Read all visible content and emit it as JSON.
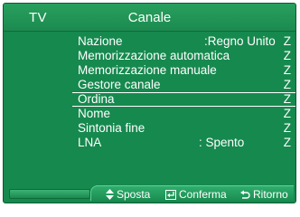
{
  "header": {
    "source": "TV",
    "title": "Canale"
  },
  "menu": [
    {
      "label": "Nazione",
      "value": ":Regno Unito",
      "arrow": "Z",
      "selected": false
    },
    {
      "label": "Memorizzazione automatica",
      "value": "",
      "arrow": "Z",
      "selected": false
    },
    {
      "label": "Memorizzazione manuale",
      "value": "",
      "arrow": "Z",
      "selected": false
    },
    {
      "label": "Gestore canale",
      "value": "",
      "arrow": "Z",
      "selected": false
    },
    {
      "label": "Ordina",
      "value": "",
      "arrow": "Z",
      "selected": true
    },
    {
      "label": "Nome",
      "value": "",
      "arrow": "Z",
      "selected": false
    },
    {
      "label": "Sintonia fine",
      "value": "",
      "arrow": "Z",
      "selected": false
    },
    {
      "label": "LNA",
      "value": ": Spento",
      "arrow": "Z",
      "selected": false
    }
  ],
  "footer": {
    "move": {
      "icon": "up-down-arrows-icon",
      "label": "Sposta"
    },
    "confirm": {
      "icon": "enter-icon",
      "label": "Conferma"
    },
    "back": {
      "icon": "return-icon",
      "label": "Ritorno"
    }
  },
  "colors": {
    "background": "#16894e",
    "text": "#ffffff",
    "selection_border": "#ffffff"
  }
}
